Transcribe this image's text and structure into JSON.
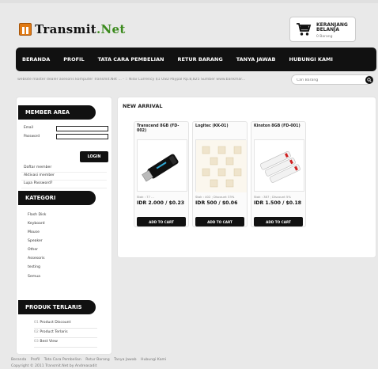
{
  "logo": {
    "part1": "Transmit",
    "part2": ".Net"
  },
  "cart": {
    "title": "KERANJANG BELANJA",
    "count": "0 Barang"
  },
  "nav": [
    "BERANDA",
    "PROFIL",
    "TATA CARA PEMBELIAN",
    "RETUR BARANG",
    "TANYA JAWAB",
    "HUBUNGI KAMI"
  ],
  "ticker": "website master dealer asesoris komputer Transmit.Net ... - :: Nilai Currency $1 USD Paypal Rp.8,825 Sumber www.bankmar...",
  "search": {
    "placeholder": "Cari Barang"
  },
  "member": {
    "title": "MEMBER AREA",
    "email_label": "Email",
    "password_label": "Password",
    "login_label": "LOGIN",
    "links": [
      "Daftar member",
      "Aktivasi member",
      "Lupa Password?"
    ]
  },
  "kategori": {
    "title": "KATEGORI",
    "items": [
      "Flash Disk",
      "Keyboard",
      "Mouse",
      "Speaker",
      "Other",
      "Assesoris",
      "testing",
      "Semua"
    ]
  },
  "terlaris": {
    "title": "PRODUK TERLARIS",
    "items": [
      {
        "num": "01",
        "label": "Product Discount"
      },
      {
        "num": "02",
        "label": "Product Terlaris"
      },
      {
        "num": "03",
        "label": "Best View"
      }
    ]
  },
  "main": {
    "section_title": "NEW ARRIVAL",
    "products": [
      {
        "name": "Transcend 8GB (FD-002)",
        "stock": "Stok : 77 ...",
        "price": "IDR 2.000 / $0.23",
        "add_label": "ADD TO CART"
      },
      {
        "name": "Logitec (KK-01)",
        "stock": "Stok : 402 ; Discount 33%",
        "price": "IDR 500 / $0.06",
        "add_label": "ADD TO CART"
      },
      {
        "name": "Kinston 8GB (FD-001)",
        "stock": "Stok : 387 ; Discount 5%",
        "price": "IDR 1.500 / $0.18",
        "add_label": "ADD TO CART"
      }
    ]
  },
  "footer": {
    "links": [
      "Beranda",
      "Profil",
      "Tata Cara Pembelian",
      "Retur Barang",
      "Tanya Jawab",
      "Hubungi Kami"
    ],
    "copyright": "Copyright © 2011 Transmit.Net by Andreasadit"
  },
  "colors": {
    "nav_bg": "#111111",
    "logo_orange": "#e07a14",
    "logo_green": "#3b8a1d"
  }
}
